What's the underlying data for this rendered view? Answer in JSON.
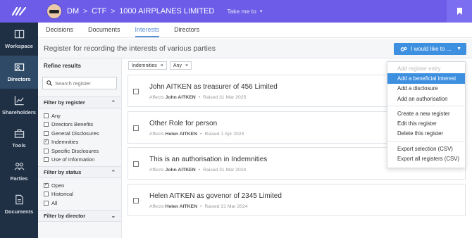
{
  "rail": {
    "items": [
      {
        "label": "Workspace"
      },
      {
        "label": "Directors"
      },
      {
        "label": "Shareholders"
      },
      {
        "label": "Tools"
      },
      {
        "label": "Parties"
      },
      {
        "label": "Documents"
      }
    ]
  },
  "topbar": {
    "crumb1": "DM",
    "crumb2": "CTF",
    "crumb3": "1000 AIRPLANES LIMITED",
    "takeme": "Take me to"
  },
  "tabs": [
    "Decisions",
    "Documents",
    "Interests",
    "Directors"
  ],
  "page": {
    "title": "Register for recording the interests of various parties",
    "action_label": "I would like to ..."
  },
  "filters": {
    "title": "Refine results",
    "search_placeholder": "Search register",
    "register": {
      "heading": "Filter by register",
      "options": [
        "Any",
        "Directors Benefits",
        "General Disclosures",
        "Indemnities",
        "Specific Disclosures",
        "Use of Information"
      ]
    },
    "status": {
      "heading": "Filter by status",
      "options": [
        "Open",
        "Historical",
        "All"
      ]
    },
    "director": {
      "heading": "Filter by director"
    }
  },
  "chips": [
    "Indemnities",
    "Any"
  ],
  "cards": [
    {
      "title": "John AITKEN as treasurer of 456 Limited",
      "affects_label": "Affects",
      "person": "John AITKEN",
      "raised": "Raised 31 Mar 2025"
    },
    {
      "title": "Other Role for person",
      "affects_label": "Affects",
      "person": "Helen AITKEN",
      "raised": "Raised 1 Apr 2024"
    },
    {
      "title": "This is an authorisation in Indemnities",
      "affects_label": "Affects",
      "person": "John AITKEN",
      "raised": "Raised 31 Mar 2024"
    },
    {
      "title": "Helen AITKEN as govenor of 2345 Limited",
      "affects_label": "Affects",
      "person": "Helen AITKEN",
      "raised": "Raised 31 Mar 2024"
    }
  ],
  "menu": {
    "add_register_entry": "Add register entry",
    "add_beneficial": "Add a beneficial interest",
    "add_disclosure": "Add a disclosure",
    "add_authorisation": "Add an authorisation",
    "create_register": "Create a new register",
    "edit_register": "Edit this register",
    "delete_register": "Delete this register",
    "export_selection": "Export selection (CSV)",
    "export_all": "Export all registers (CSV)"
  },
  "colors": {
    "brand": "#6c5ce7",
    "accent": "#3d8fe0",
    "rail": "#1f3044"
  }
}
